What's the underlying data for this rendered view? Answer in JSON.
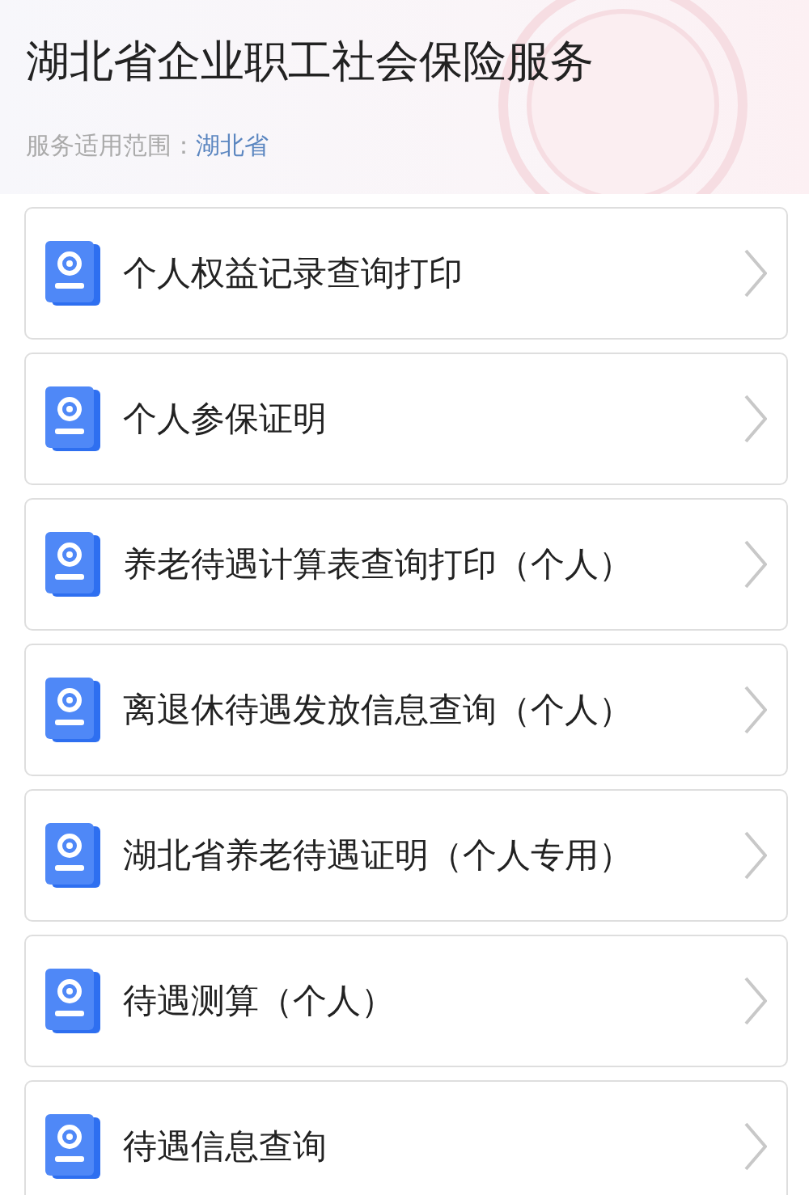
{
  "header": {
    "title": "湖北省企业职工社会保险服务",
    "scope_label": "服务适用范围：",
    "scope_value": "湖北省"
  },
  "services": [
    {
      "label": "个人权益记录查询打印"
    },
    {
      "label": "个人参保证明"
    },
    {
      "label": "养老待遇计算表查询打印（个人）"
    },
    {
      "label": "离退休待遇发放信息查询（个人）"
    },
    {
      "label": "湖北省养老待遇证明（个人专用）"
    },
    {
      "label": "待遇测算（个人）"
    },
    {
      "label": "待遇信息查询"
    }
  ]
}
